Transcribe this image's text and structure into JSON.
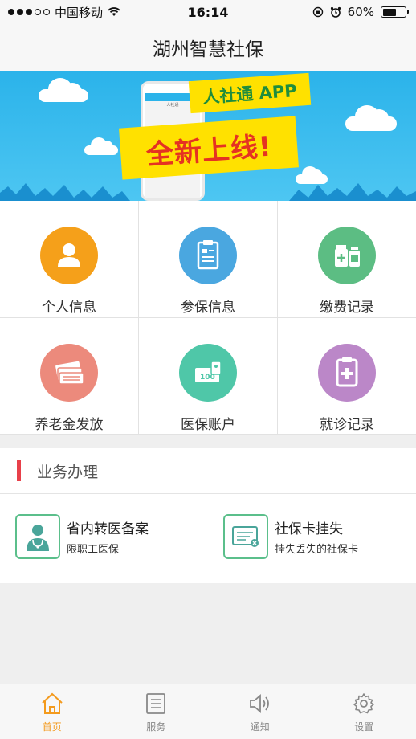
{
  "status_bar": {
    "carrier": "中国移动",
    "time": "16:14",
    "battery": "60%",
    "battery_level": 0.6
  },
  "header": {
    "title": "湖州智慧社保"
  },
  "banner": {
    "tag": "人社通 APP",
    "headline": "全新上线!",
    "phone_title": "人社通"
  },
  "grid": [
    {
      "label": "个人信息",
      "icon": "person-icon",
      "color": "#f5a01a"
    },
    {
      "label": "参保信息",
      "icon": "clipboard-icon",
      "color": "#4aa7e0"
    },
    {
      "label": "缴费记录",
      "icon": "medicine-bottles-icon",
      "color": "#5cbd83"
    },
    {
      "label": "养老金发放",
      "icon": "cash-stack-icon",
      "color": "#ec8a7c"
    },
    {
      "label": "医保账户",
      "icon": "card-100-icon",
      "color": "#4fc7a8"
    },
    {
      "label": "就诊记录",
      "icon": "medical-clipboard-icon",
      "color": "#bb87c8"
    }
  ],
  "business": {
    "title": "业务办理",
    "items": [
      {
        "title": "省内转医备案",
        "subtitle": "限职工医保",
        "icon": "doctor-icon"
      },
      {
        "title": "社保卡挂失",
        "subtitle": "挂失丢失的社保卡",
        "icon": "card-lost-icon"
      }
    ]
  },
  "tabbar": [
    {
      "label": "首页",
      "icon": "home-icon",
      "active": true
    },
    {
      "label": "服务",
      "icon": "list-icon",
      "active": false
    },
    {
      "label": "通知",
      "icon": "speaker-icon",
      "active": false
    },
    {
      "label": "设置",
      "icon": "gear-icon",
      "active": false
    }
  ]
}
